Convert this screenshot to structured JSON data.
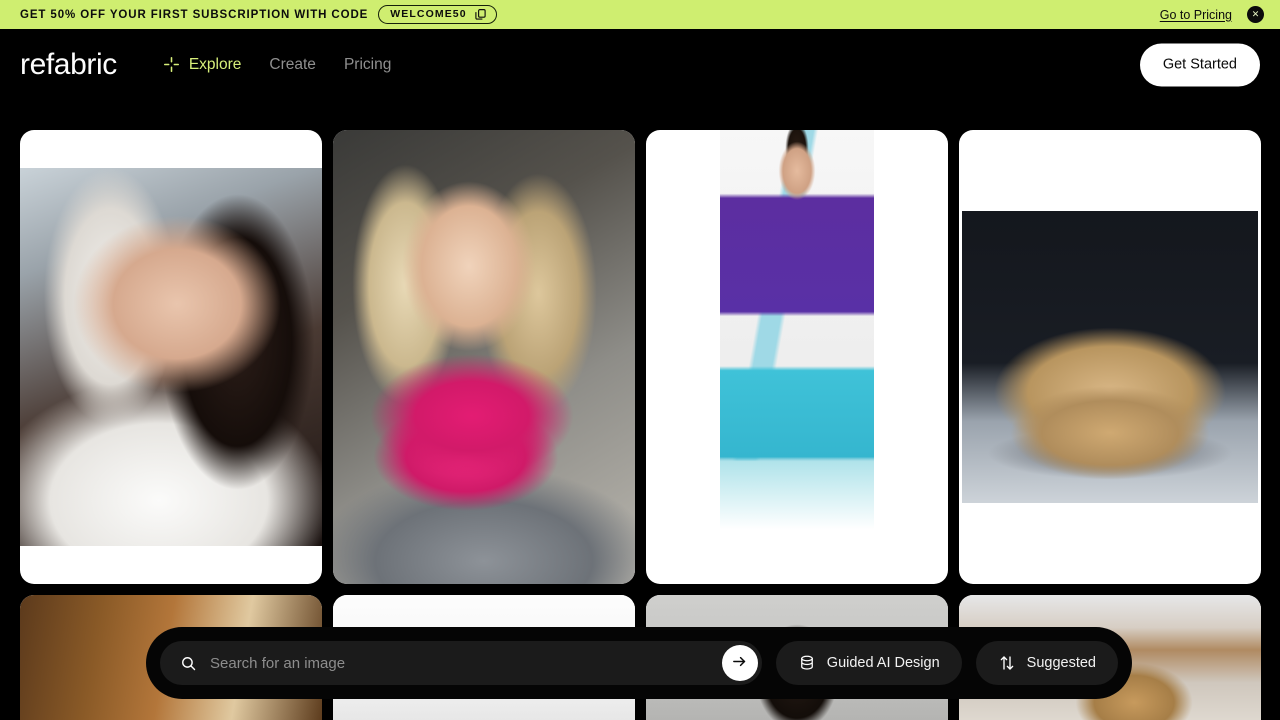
{
  "promo": {
    "text": "GET 50% OFF YOUR FIRST SUBSCRIPTION WITH CODE",
    "code": "WELCOME50",
    "copy_icon": "copy-icon",
    "link": "Go to Pricing",
    "close_icon": "✕",
    "bg_color": "#cfee70",
    "fg_color": "#0c0c0c"
  },
  "header": {
    "logo": "refabric",
    "nav": [
      {
        "label": "Explore",
        "active": true,
        "icon": "sparkle-icon"
      },
      {
        "label": "Create",
        "active": false,
        "icon": ""
      },
      {
        "label": "Pricing",
        "active": false,
        "icon": ""
      }
    ],
    "cta": "Get Started",
    "accent_color": "#d7ef7a",
    "bg_color": "#000000"
  },
  "gallery": {
    "cards": [
      {
        "name": "portrait-dark-haired-woman-white-hood",
        "style": "inset-v",
        "art": "ph-woman1"
      },
      {
        "name": "portrait-blonde-woman-pink-scarf",
        "style": "bleed",
        "art": "ph-woman2"
      },
      {
        "name": "model-purple-teal-embroidered-kurta",
        "style": "inset-w",
        "art": "ph-kurta"
      },
      {
        "name": "beige-ceramic-sculptural-vessel",
        "style": "inset-sq",
        "art": "ph-vase"
      }
    ],
    "cards_row2": [
      {
        "name": "interior-warm-wooden-room",
        "art": "ph-interior"
      },
      {
        "name": "portrait-on-white-background",
        "art": "ph-white"
      },
      {
        "name": "portrait-curly-hair-grey-background",
        "art": "ph-gray"
      },
      {
        "name": "portrait-woman-european-street",
        "art": "ph-street"
      }
    ]
  },
  "search": {
    "placeholder": "Search for an image",
    "value": "",
    "search_icon": "search-icon",
    "submit_icon": "arrow-right-icon",
    "chips": [
      {
        "label": "Guided AI Design",
        "icon": "layers-stack-icon"
      },
      {
        "label": "Suggested",
        "icon": "sort-arrows-icon"
      }
    ]
  }
}
